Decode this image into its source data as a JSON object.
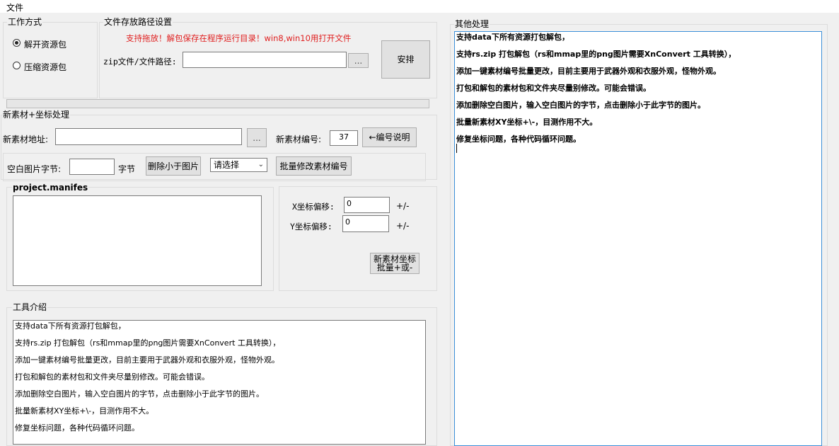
{
  "menu": {
    "file": "文件"
  },
  "mode_group": {
    "title": "工作方式",
    "options": [
      {
        "label": "解开资源包",
        "checked": true
      },
      {
        "label": "压缩资源包",
        "checked": false
      }
    ]
  },
  "path_group": {
    "title": "文件存放路径设置",
    "notice": "支持拖放！解包保存在程序运行目录！win8,win10用打开文件",
    "notice_color": "#e02020",
    "zip_label": "zip文件/文件路径:",
    "zip_value": "",
    "browse_label": "...",
    "arrange_button": "安排"
  },
  "progress": {
    "value": 0
  },
  "material_group": {
    "title": "新素材+坐标处理",
    "address_label": "新素材地址:",
    "address_value": "",
    "browse_label": "...",
    "number_label": "新素材编号:",
    "number_value": "37",
    "number_help_button": "←编号说明",
    "blank_label": "空白图片字节:",
    "blank_value": "",
    "byte_unit": "字节",
    "delete_small_button": "删除小于图片",
    "select_value": "请选择",
    "batch_number_button": "批量修改素材编号"
  },
  "manifest_group": {
    "title": "project.manifes"
  },
  "offset_group": {
    "x_label": "X坐标偏移:",
    "x_value": "0",
    "x_suffix": "+/-",
    "y_label": "Y坐标偏移:",
    "y_value": "0",
    "y_suffix": "+/-",
    "batch_button_line1": "新素材坐标",
    "batch_button_line2": "批量+或-"
  },
  "intro_group": {
    "title": "工具介绍",
    "lines": [
      "支持data下所有资源打包解包，",
      "支持rs.zip 打包解包（rs和mmap里的png图片需要XnConvert 工具转换），",
      "添加一键素材编号批量更改，目前主要用于武器外观和衣服外观，怪物外观。",
      "打包和解包的素材包和文件夹尽量别修改。可能会错误。",
      "添加删除空白图片，输入空白图片的字节，点击删除小于此字节的图片。",
      "批量新素材XY坐标+\\-，目测作用不大。",
      "修复坐标问题，各种代码循环问题。"
    ]
  },
  "other_group": {
    "title": "其他处理",
    "lines": [
      "支持data下所有资源打包解包，",
      "支持rs.zip 打包解包（rs和mmap里的png图片需要XnConvert 工具转换），",
      "添加一键素材编号批量更改，目前主要用于武器外观和衣服外观，怪物外观。",
      "打包和解包的素材包和文件夹尽量别修改。可能会错误。",
      "添加删除空白图片，输入空白图片的字节，点击删除小于此字节的图片。",
      "批量新素材XY坐标+\\-，目测作用不大。",
      "修复坐标问题，各种代码循环问题。"
    ]
  }
}
